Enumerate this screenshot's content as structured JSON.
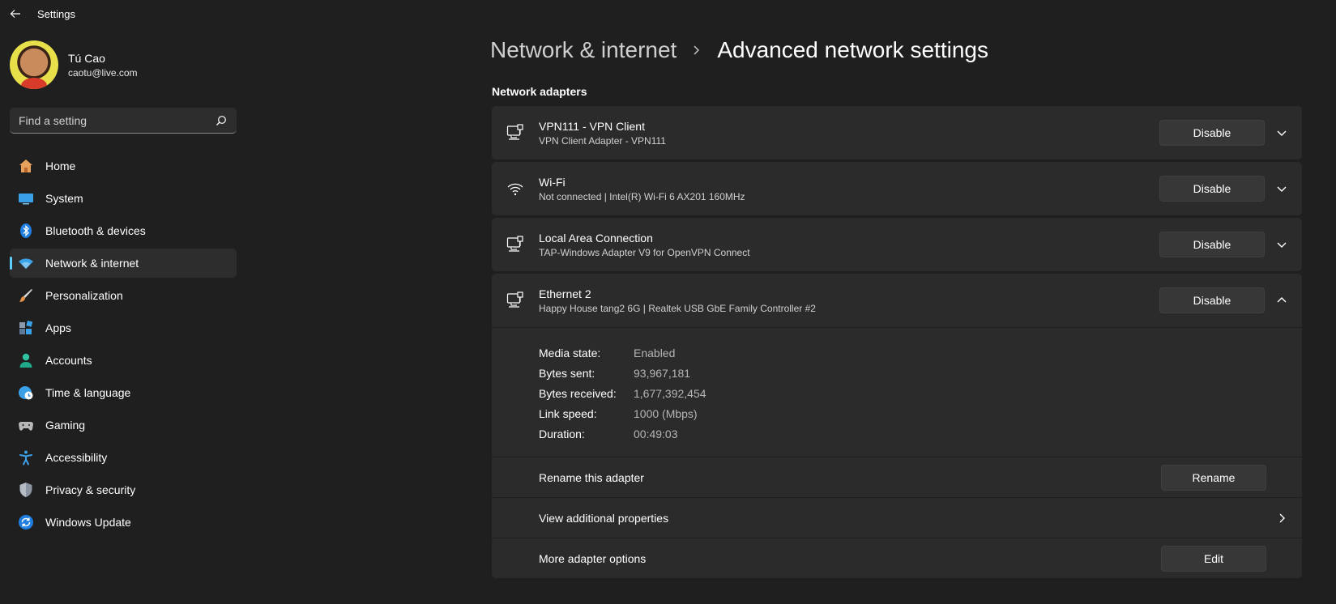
{
  "titlebar": {
    "title": "Settings"
  },
  "profile": {
    "name": "Tú Cao",
    "email": "caotu@live.com"
  },
  "search": {
    "placeholder": "Find a setting"
  },
  "sidebar": {
    "items": [
      {
        "label": "Home",
        "icon": "home-icon",
        "active": false
      },
      {
        "label": "System",
        "icon": "system-icon",
        "active": false
      },
      {
        "label": "Bluetooth & devices",
        "icon": "bluetooth-icon",
        "active": false
      },
      {
        "label": "Network & internet",
        "icon": "wifi-icon",
        "active": true
      },
      {
        "label": "Personalization",
        "icon": "brush-icon",
        "active": false
      },
      {
        "label": "Apps",
        "icon": "apps-icon",
        "active": false
      },
      {
        "label": "Accounts",
        "icon": "person-icon",
        "active": false
      },
      {
        "label": "Time & language",
        "icon": "globe-clock-icon",
        "active": false
      },
      {
        "label": "Gaming",
        "icon": "gamepad-icon",
        "active": false
      },
      {
        "label": "Accessibility",
        "icon": "accessibility-icon",
        "active": false
      },
      {
        "label": "Privacy & security",
        "icon": "shield-icon",
        "active": false
      },
      {
        "label": "Windows Update",
        "icon": "update-icon",
        "active": false
      }
    ]
  },
  "breadcrumb": {
    "parent": "Network & internet",
    "current": "Advanced network settings"
  },
  "section": {
    "title": "Network adapters"
  },
  "adapters": [
    {
      "name": "VPN111 - VPN Client",
      "desc": "VPN Client Adapter - VPN111",
      "button": "Disable",
      "icon": "ethernet-icon",
      "expanded": false
    },
    {
      "name": "Wi-Fi",
      "desc": "Not connected | Intel(R) Wi-Fi 6 AX201 160MHz",
      "button": "Disable",
      "icon": "wifi-icon",
      "expanded": false
    },
    {
      "name": "Local Area Connection",
      "desc": "TAP-Windows Adapter V9 for OpenVPN Connect",
      "button": "Disable",
      "icon": "ethernet-icon",
      "expanded": false
    },
    {
      "name": "Ethernet 2",
      "desc": "Happy House tang2 6G | Realtek USB GbE Family Controller #2",
      "button": "Disable",
      "icon": "ethernet-icon",
      "expanded": true
    }
  ],
  "details": [
    {
      "key": "Media state:",
      "value": "Enabled"
    },
    {
      "key": "Bytes sent:",
      "value": "93,967,181"
    },
    {
      "key": "Bytes received:",
      "value": "1,677,392,454"
    },
    {
      "key": "Link speed:",
      "value": "1000 (Mbps)"
    },
    {
      "key": "Duration:",
      "value": "00:49:03"
    }
  ],
  "actions": {
    "rename_label": "Rename this adapter",
    "rename_button": "Rename",
    "properties_label": "View additional properties",
    "more_label": "More adapter options",
    "edit_button": "Edit"
  },
  "colors": {
    "accent": "#60cdff",
    "background": "#1f1f1f",
    "card": "#2b2b2b"
  }
}
